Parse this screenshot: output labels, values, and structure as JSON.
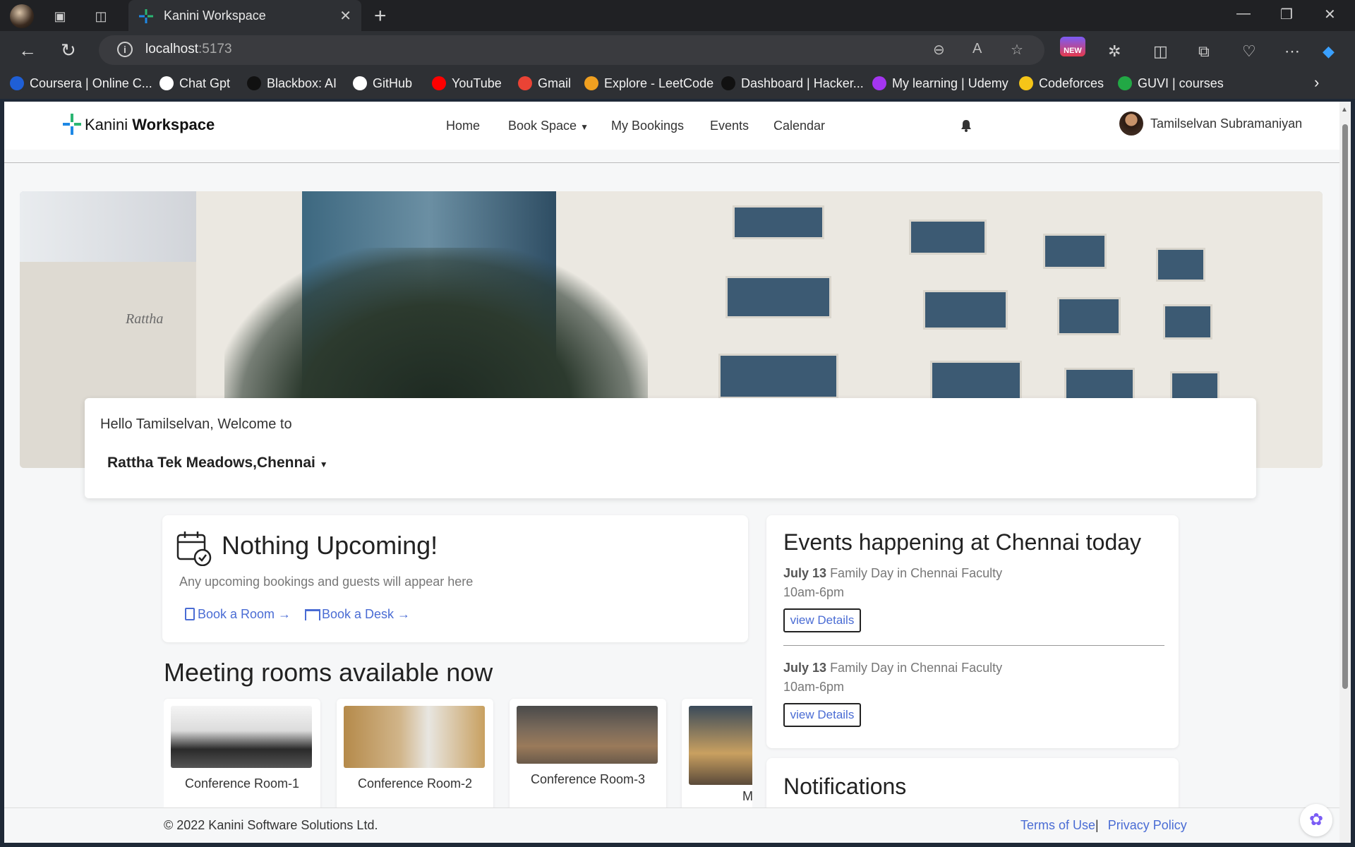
{
  "browser": {
    "tab_title": "Kanini Workspace",
    "url_host": "localhost",
    "url_port": ":5173",
    "new_badge": "NEW",
    "bookmarks": [
      {
        "label": "Coursera | Online C...",
        "color": "#1f5fd6"
      },
      {
        "label": "Chat Gpt",
        "color": "#ffffff"
      },
      {
        "label": "Blackbox: AI",
        "color": "#111111"
      },
      {
        "label": "GitHub",
        "color": "#ffffff"
      },
      {
        "label": "YouTube",
        "color": "#ff0000"
      },
      {
        "label": "Gmail",
        "color": "#ea4335"
      },
      {
        "label": "Explore - LeetCode",
        "color": "#f0a020"
      },
      {
        "label": "Dashboard | Hacker...",
        "color": "#111111"
      },
      {
        "label": "My learning | Udemy",
        "color": "#a435f0"
      },
      {
        "label": "Codeforces",
        "color": "#f5c518"
      },
      {
        "label": "GUVI | courses",
        "color": "#22a845"
      }
    ]
  },
  "navbar": {
    "brand_light": "Kanini",
    "brand_bold": "Workspace",
    "links": [
      "Home",
      "Book Space",
      "My Bookings",
      "Events",
      "Calendar"
    ],
    "user_name": "Tamilselvan Subramaniyan"
  },
  "welcome": {
    "greeting": "Hello Tamilselvan, Welcome to",
    "location": "Rattha Tek Meadows,Chennai"
  },
  "upcoming": {
    "title": "Nothing Upcoming!",
    "subtitle": "Any upcoming bookings and guests will appear here",
    "book_room": "Book a Room →",
    "book_desk": "Book a Desk →"
  },
  "meeting_rooms": {
    "title": "Meeting rooms available now",
    "rooms": [
      "Conference Room-1",
      "Conference Room-2",
      "Conference Room-3",
      "Meetir"
    ]
  },
  "events": {
    "title": "Events happening at Chennai today",
    "items": [
      {
        "date": "July 13",
        "name": "Family Day in Chennai Faculty",
        "time": "10am-6pm",
        "button": "view Details"
      },
      {
        "date": "July 13",
        "name": "Family Day in Chennai Faculty",
        "time": "10am-6pm",
        "button": "view Details"
      }
    ]
  },
  "notifications": {
    "title": "Notifications"
  },
  "footer": {
    "copyright": "© 2022 Kanini Software Solutions Ltd.",
    "terms": "Terms of Use",
    "separator": "|",
    "privacy": "Privacy Policy"
  },
  "colors": {
    "link": "#4a6cd4",
    "accent_green": "#2bb673",
    "accent_blue": "#1e88e5"
  }
}
